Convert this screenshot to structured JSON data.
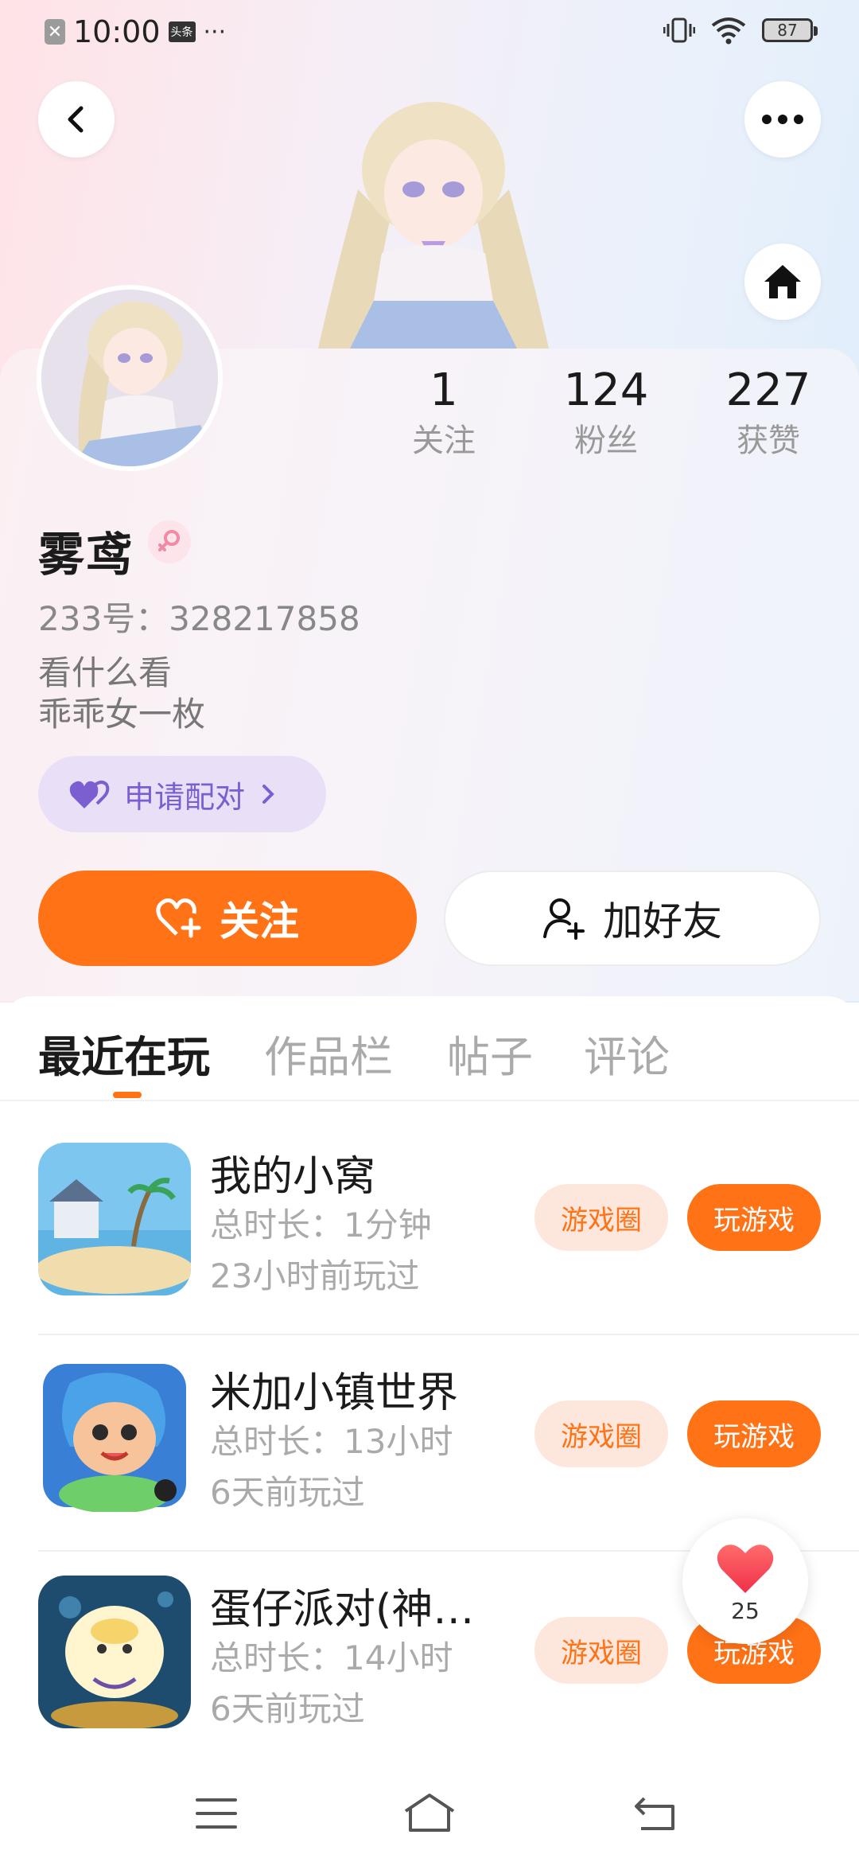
{
  "status_bar": {
    "time": "10:00",
    "source_badge": "头条",
    "dots": "···",
    "battery": "87"
  },
  "icons": [
    "close-notice-icon",
    "toutiao-icon",
    "vibrate-icon",
    "wifi-icon",
    "battery-icon",
    "back-icon",
    "more-icon",
    "home-icon",
    "female-icon",
    "heart-pair-icon",
    "chevron-right-icon",
    "heart-plus-icon",
    "add-friend-icon",
    "like-heart-icon",
    "menu-icon",
    "home-nav-icon",
    "back-nav-icon"
  ],
  "stats": [
    {
      "value": "1",
      "label": "关注"
    },
    {
      "value": "124",
      "label": "粉丝"
    },
    {
      "value": "227",
      "label": "获赞"
    }
  ],
  "profile": {
    "name": "雾鸢",
    "id_line": "233号：328217858",
    "bio_line1": "看什么看",
    "bio_line2": "乖乖女一枚",
    "pair_label": "申请配对"
  },
  "actions": {
    "follow": "关注",
    "add_friend": "加好友"
  },
  "tabs": [
    "最近在玩",
    "作品栏",
    "帖子",
    "评论"
  ],
  "games": [
    {
      "name": "我的小窝",
      "duration": "总时长：1分钟",
      "last_played": "23小时前玩过",
      "circle": "游戏圈",
      "play": "玩游戏"
    },
    {
      "name": "米加小镇世界",
      "duration": "总时长：13小时",
      "last_played": "6天前玩过",
      "circle": "游戏圈",
      "play": "玩游戏"
    },
    {
      "name": "蛋仔派对(神…",
      "duration": "总时长：14小时",
      "last_played": "6天前玩过",
      "circle": "游戏圈",
      "play": "玩游戏"
    }
  ],
  "like_float": {
    "count": "25"
  },
  "colors": {
    "accent": "#ff7216",
    "pair_purple": "#7b5fd1",
    "muted": "#999999"
  }
}
